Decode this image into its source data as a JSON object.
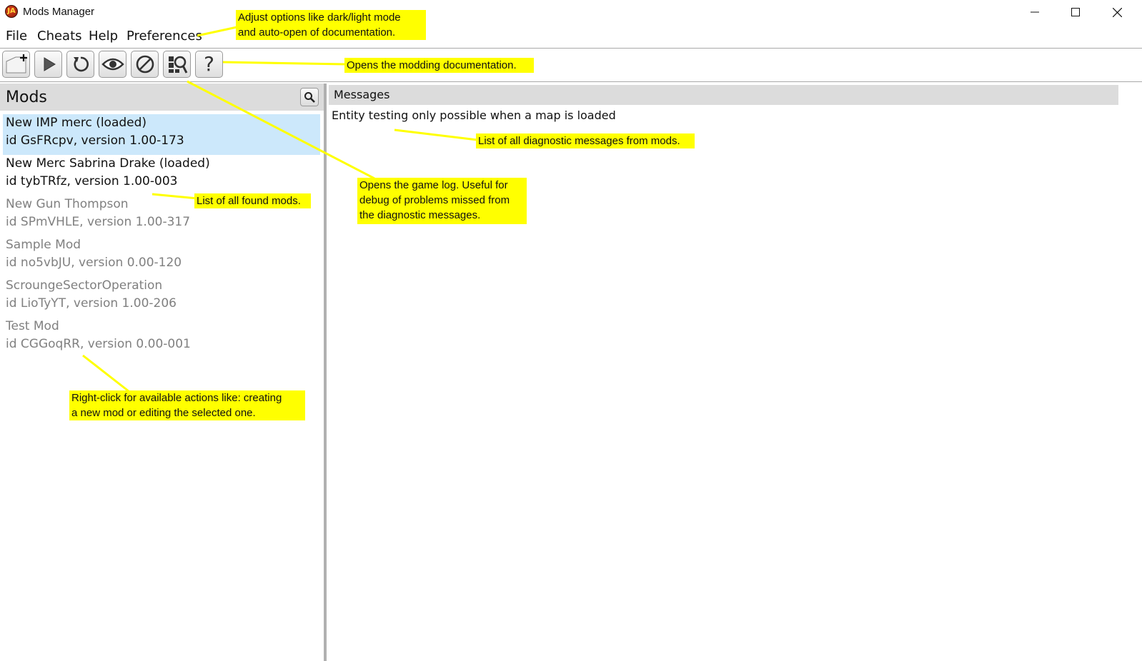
{
  "window": {
    "title": "Mods Manager",
    "icon": "app-logo-icon",
    "controls": [
      "minimize-icon",
      "maximize-icon",
      "close-icon"
    ]
  },
  "menu": {
    "items": [
      {
        "label": "File"
      },
      {
        "label": "Cheats"
      },
      {
        "label": "Help"
      },
      {
        "label": "Preferences"
      }
    ]
  },
  "toolbar": {
    "buttons": [
      {
        "icon": "new-mod-icon"
      },
      {
        "icon": "play-icon"
      },
      {
        "icon": "reload-icon"
      },
      {
        "icon": "eye-icon"
      },
      {
        "icon": "disable-icon"
      },
      {
        "icon": "game-log-icon"
      },
      {
        "icon": "help-icon",
        "glyph": "?"
      }
    ]
  },
  "mods_panel": {
    "title": "Mods",
    "search_icon": "search-icon",
    "selected_color": "#cce8fb",
    "items": [
      {
        "name": "New IMP merc (loaded)",
        "id_line": "id GsFRcpv, version 1.00-173",
        "state": "loaded",
        "selected": true
      },
      {
        "name": "New Merc Sabrina Drake (loaded)",
        "id_line": "id tybTRfz, version 1.00-003",
        "state": "loaded",
        "selected": false
      },
      {
        "name": "New Gun Thompson",
        "id_line": "id SPmVHLE, version 1.00-317",
        "state": "unloaded",
        "selected": false
      },
      {
        "name": "Sample Mod",
        "id_line": "id no5vbJU, version 0.00-120",
        "state": "unloaded",
        "selected": false
      },
      {
        "name": "ScroungeSectorOperation",
        "id_line": "id LioTyYT, version 1.00-206",
        "state": "unloaded",
        "selected": false
      },
      {
        "name": "Test Mod",
        "id_line": "id CGGoqRR, version 0.00-001",
        "state": "unloaded",
        "selected": false
      }
    ]
  },
  "messages_panel": {
    "title": "Messages",
    "messages": [
      "Entity testing only possible when a map is loaded"
    ]
  },
  "annotations": {
    "color": "#ffff00",
    "preferences": [
      "Adjust options like dark/light mode",
      "and auto-open of documentation."
    ],
    "docs": [
      "Opens the modding documentation."
    ],
    "diagnostics": [
      "List of all diagnostic messages from mods."
    ],
    "game_log": [
      "Opens the game log. Useful for",
      "debug of problems missed from",
      "the diagnostic messages."
    ],
    "found_mods": [
      "List of all found mods."
    ],
    "right_click": [
      "Right-click for available actions like: creating",
      "a new mod or editing the selected one."
    ]
  }
}
